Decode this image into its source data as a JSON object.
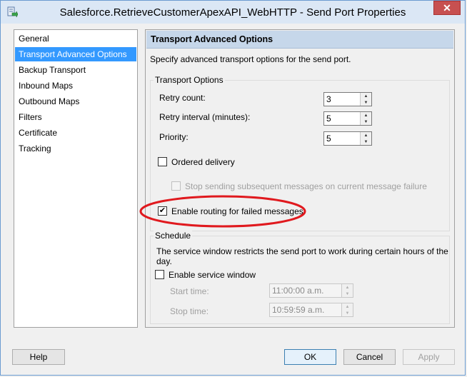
{
  "window": {
    "title": "Salesforce.RetrieveCustomerApexAPI_WebHTTP - Send Port Properties",
    "close_glyph": "✕"
  },
  "nav": {
    "items": [
      {
        "label": "General"
      },
      {
        "label": "Transport Advanced Options",
        "selected": true
      },
      {
        "label": "Backup Transport"
      },
      {
        "label": "Inbound Maps"
      },
      {
        "label": "Outbound Maps"
      },
      {
        "label": "Filters"
      },
      {
        "label": "Certificate"
      },
      {
        "label": "Tracking"
      }
    ]
  },
  "content": {
    "header": "Transport Advanced Options",
    "description": "Specify advanced transport options for the send port.",
    "transport_options": {
      "title": "Transport Options",
      "retry_count_label": "Retry count:",
      "retry_count_value": "3",
      "retry_interval_label": "Retry interval (minutes):",
      "retry_interval_value": "5",
      "priority_label": "Priority:",
      "priority_value": "5",
      "ordered_delivery_label": "Ordered delivery",
      "ordered_delivery_checked": false,
      "stop_sending_label": "Stop sending subsequent messages on current message failure",
      "stop_sending_checked": false,
      "enable_routing_label": "Enable routing for failed messages",
      "enable_routing_checked": true,
      "check_glyph": "✔"
    },
    "schedule": {
      "title": "Schedule",
      "description": "The service window restricts the send port to work during certain hours of the day.",
      "enable_service_window_label": "Enable service window",
      "enable_service_window_checked": false,
      "start_time_label": "Start time:",
      "start_time_value": "11:00:00 a.m.",
      "stop_time_label": "Stop time:",
      "stop_time_value": "10:59:59 a.m."
    }
  },
  "buttons": {
    "help": "Help",
    "ok": "OK",
    "cancel": "Cancel",
    "apply": "Apply"
  },
  "spin_glyphs": {
    "up": "▲",
    "down": "▼"
  },
  "colors": {
    "selection": "#3399ff",
    "annotation": "#e0191e",
    "close_button": "#c75050"
  }
}
